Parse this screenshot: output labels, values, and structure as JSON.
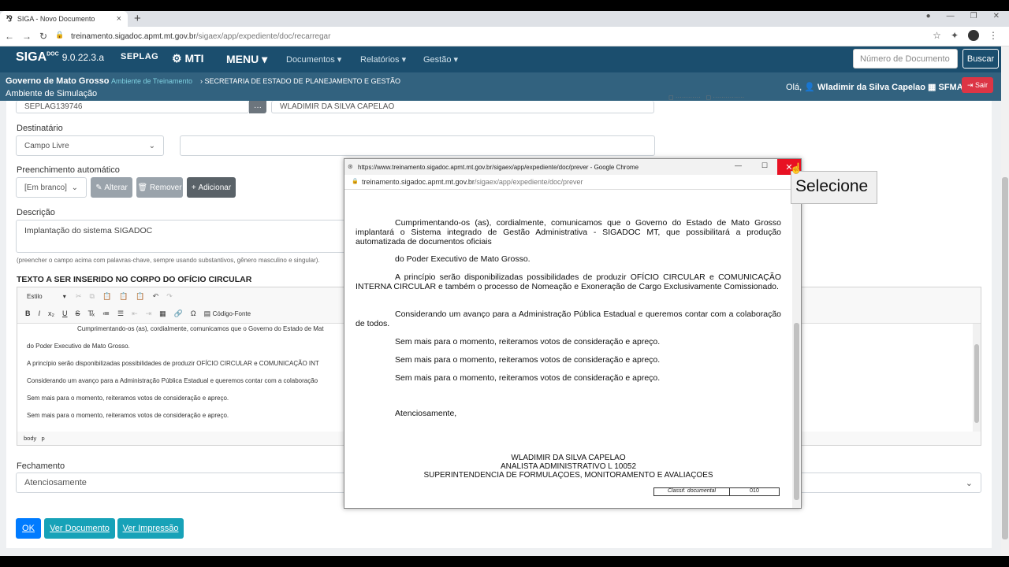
{
  "browser": {
    "tab_title": "SIGA - Novo Documento",
    "url_host": "treinamento.sigadoc.apmt.mt.gov.br",
    "url_path": "/sigaex/app/expediente/doc/recarregar"
  },
  "app": {
    "brand": "SIGA",
    "brand_sup": "DOC",
    "version": "9.0.22.3.a",
    "seplag": "SEPLAG",
    "mti": "MTI",
    "menu_label": "MENU ▾",
    "nav": [
      "Documentos ▾",
      "Relatórios ▾",
      "Gestão ▾"
    ],
    "search_placeholder": "Número de Documento",
    "search_button": "Buscar",
    "org": "Governo de Mato Grosso",
    "env_link": "Ambiente de Treinamento",
    "secretaria": "› SECRETARIA DE ESTADO DE PLANEJAMENTO E GESTÃO",
    "sim": "Ambiente de Simulação",
    "greeting": "Olá,",
    "user": "Wladimir da Silva Capelao",
    "unit": "SFMA",
    "logout": "Sair"
  },
  "form": {
    "matricula": "SEPLAG139746",
    "nome": "WLADIMIR DA SILVA CAPELAO",
    "destinatario_label": "Destinatário",
    "destinatario_value": "Campo Livre",
    "preench_label": "Preenchimento automático",
    "preench_value": "[Em branco]",
    "btn_alterar": "Alterar",
    "btn_remover": "Remover",
    "btn_adicionar": "Adicionar",
    "descricao_label": "Descrição",
    "descricao_value": "Implantação do sistema SIGADOC",
    "descricao_hint": "(preencher o campo acima com palavras-chave, sempre usando substantivos, gênero masculino e singular).",
    "texto_label": "TEXTO A SER INSERIDO NO CORPO DO OFÍCIO CIRCULAR",
    "estilo": "Estilo",
    "codigo_fonte": "Código-Fonte",
    "editor_lines": [
      "Cumprimentando-os (as), cordialmente, comunicamos que o Governo do Estado de Mat",
      "do Poder Executivo de Mato Grosso.",
      "A princípio serão disponibilizadas possibilidades de produzir OFÍCIO CIRCULAR e COMUNICAÇÃO INT",
      "Considerando um avanço para a Administração Pública Estadual e queremos contar com a colaboração",
      "Sem mais para o momento, reiteramos votos de consideração e apreço.",
      "Sem mais para o momento, reiteramos votos de consideração e apreço."
    ],
    "path_body": "body",
    "path_p": "p",
    "fechamento_label": "Fechamento",
    "fechamento_value": "Atenciosamente",
    "btn_ok": "OK",
    "btn_ver_doc": "Ver Documento",
    "btn_ver_imp": "Ver Impressão"
  },
  "popup": {
    "title": "https://www.treinamento.sigadoc.apmt.mt.gov.br/sigaex/app/expediente/doc/prever - Google Chrome",
    "url_host": "treinamento.sigadoc.apmt.mt.gov.br",
    "url_path": "/sigaex/app/expediente/doc/prever",
    "p1": "Cumprimentando-os (as), cordialmente, comunicamos que o Governo do Estado de Mato Grosso implantará o Sistema integrado de Gestão Administrativa - SIGADOC MT, que possibilitará a produção automatizada de documentos oficiais",
    "p2": "do Poder Executivo de Mato Grosso.",
    "p3": "A princípio serão disponibilizadas possibilidades de produzir OFÍCIO CIRCULAR e COMUNICAÇÃO INTERNA CIRCULAR e também o processo de Nomeação e Exoneração de Cargo Exclusivamente Comissionado.",
    "p4": "Considerando um avanço para a Administração Pública Estadual e queremos contar com a colaboração de todos.",
    "p5": "Sem mais para o momento, reiteramos votos de consideração e apreço.",
    "p6": "Sem mais para o momento, reiteramos votos de consideração e apreço.",
    "p7": "Sem mais para o momento, reiteramos votos de consideração e apreço.",
    "closing": "Atenciosamente,",
    "sig_name": "WLADIMIR DA SILVA CAPELAO",
    "sig_role": "ANALISTA ADMINISTRATIVO L 10052",
    "sig_unit": "SUPERINTENDENCIA DE FORMULAÇOES, MONITORAMENTO E AVALIAÇOES",
    "classif_label": "Classif. documental",
    "classif_value": "010"
  },
  "tooltip": "Selecione"
}
